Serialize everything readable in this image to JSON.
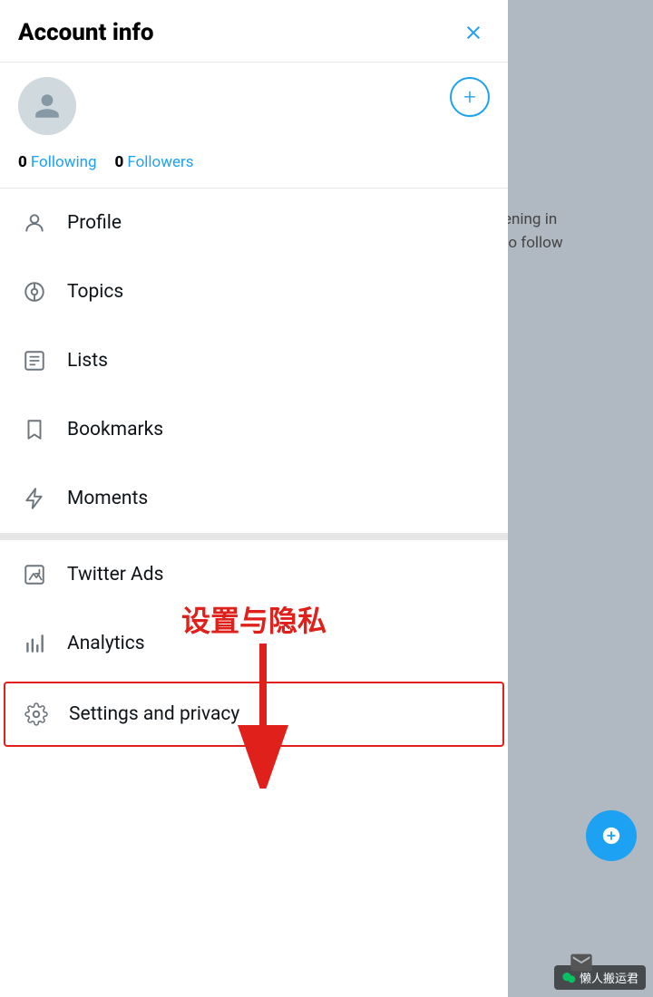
{
  "header": {
    "title": "Account info",
    "close_label": "close"
  },
  "follow": {
    "following_count": "0",
    "following_label": "Following",
    "followers_count": "0",
    "followers_label": "Followers"
  },
  "menu": {
    "items": [
      {
        "id": "profile",
        "label": "Profile",
        "icon": "person"
      },
      {
        "id": "topics",
        "label": "Topics",
        "icon": "topics"
      },
      {
        "id": "lists",
        "label": "Lists",
        "icon": "lists"
      },
      {
        "id": "bookmarks",
        "label": "Bookmarks",
        "icon": "bookmark"
      },
      {
        "id": "moments",
        "label": "Moments",
        "icon": "bolt"
      },
      {
        "id": "twitter-ads",
        "label": "Twitter Ads",
        "icon": "ads"
      },
      {
        "id": "analytics",
        "label": "Analytics",
        "icon": "analytics"
      },
      {
        "id": "settings",
        "label": "Settings and privacy",
        "icon": "gear"
      }
    ]
  },
  "annotation": {
    "text": "设置与隐私"
  },
  "right_text": {
    "line1": "ening in",
    "line2": "to follow"
  },
  "wechat": {
    "label": "懒人搬运君"
  },
  "add_button": "+",
  "compose_button": "+"
}
